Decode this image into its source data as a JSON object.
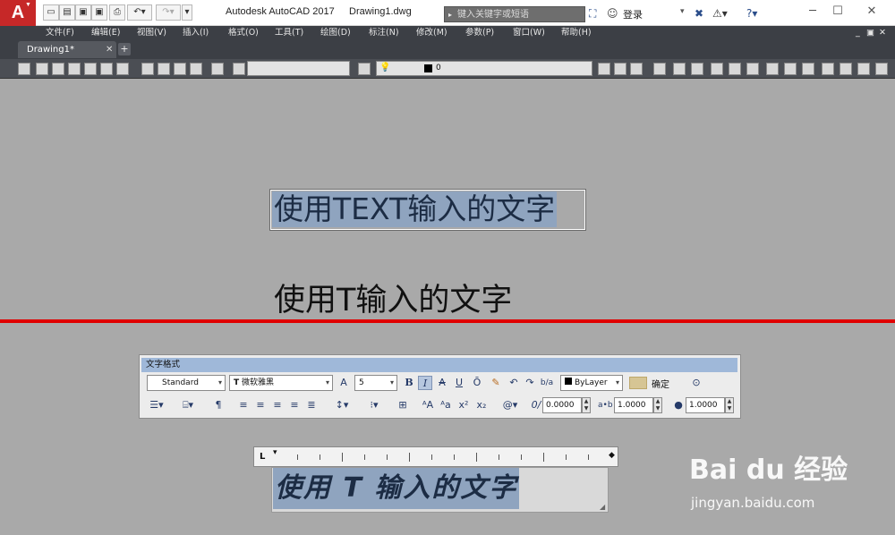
{
  "app": {
    "title": "Autodesk AutoCAD 2017",
    "document": "Drawing1.dwg",
    "logo_letter": "A"
  },
  "search": {
    "placeholder": "键入关键字或短语"
  },
  "user": {
    "login_label": "登录"
  },
  "menu": [
    "文件(F)",
    "编辑(E)",
    "视图(V)",
    "插入(I)",
    "格式(O)",
    "工具(T)",
    "绘图(D)",
    "标注(N)",
    "修改(M)",
    "参数(P)",
    "窗口(W)",
    "帮助(H)"
  ],
  "tabs": {
    "active": "Drawing1*",
    "close": "✕",
    "add": "+"
  },
  "layer": {
    "current": "0"
  },
  "canvas": {
    "text_entity_1": "使用TEXT输入的文字",
    "text_entity_2": "使用T输入的文字",
    "editing_text": "使用 T 输入的文字"
  },
  "text_format": {
    "title": "文字格式",
    "style": "Standard",
    "font": "微软雅黑",
    "height": "5",
    "color": "ByLayer",
    "ok_label": "确定",
    "oblique": "0.0000",
    "tracking": "1.0000",
    "width_factor": "1.0000",
    "bold": "B",
    "italic": "I",
    "strike": "A",
    "underline": "U",
    "overline": "Ō"
  },
  "watermark": {
    "logo": "Bai du 经验",
    "url": "jingyan.baidu.com"
  },
  "colors": {
    "accent_red": "#e00000",
    "selection": "#8fa4bf",
    "dialog_title": "#9fb8d9",
    "dark_chrome": "#3c3f45"
  }
}
